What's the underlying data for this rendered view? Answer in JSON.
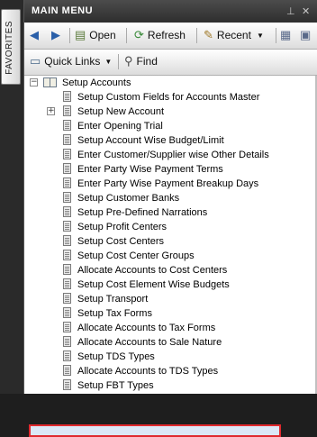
{
  "sidebar": {
    "favorites_label": "FAVORITES"
  },
  "panel": {
    "title": "MAIN MENU"
  },
  "toolbar": {
    "open_label": "Open",
    "refresh_label": "Refresh",
    "recent_label": "Recent",
    "quicklinks_label": "Quick Links",
    "find_label": "Find"
  },
  "tree": {
    "root_label": "Setup Accounts",
    "items": [
      {
        "label": "Setup Custom Fields for Accounts Master",
        "expandable": false
      },
      {
        "label": "Setup New Account",
        "expandable": true
      },
      {
        "label": "Enter Opening Trial",
        "expandable": false
      },
      {
        "label": "Setup Account Wise Budget/Limit",
        "expandable": false
      },
      {
        "label": "Enter Customer/Supplier wise Other Details",
        "expandable": false
      },
      {
        "label": "Enter Party Wise Payment Terms",
        "expandable": false
      },
      {
        "label": "Enter Party Wise Payment Breakup Days",
        "expandable": false
      },
      {
        "label": "Setup Customer Banks",
        "expandable": false
      },
      {
        "label": "Setup Pre-Defined Narrations",
        "expandable": false
      },
      {
        "label": "Setup Profit Centers",
        "expandable": false
      },
      {
        "label": "Setup Cost Centers",
        "expandable": false
      },
      {
        "label": "Setup Cost Center Groups",
        "expandable": false
      },
      {
        "label": "Allocate Accounts to Cost Centers",
        "expandable": false
      },
      {
        "label": "Setup Cost Element Wise Budgets",
        "expandable": false
      },
      {
        "label": "Setup Transport",
        "expandable": false
      },
      {
        "label": "Setup Tax Forms",
        "expandable": false
      },
      {
        "label": "Allocate Accounts to Tax Forms",
        "expandable": false
      },
      {
        "label": "Allocate Accounts to Sale Nature",
        "expandable": false
      },
      {
        "label": "Setup TDS Types",
        "expandable": false,
        "selected": true
      },
      {
        "label": "Allocate Accounts to TDS Types",
        "expandable": false
      },
      {
        "label": "Setup FBT Types",
        "expandable": false
      }
    ]
  }
}
